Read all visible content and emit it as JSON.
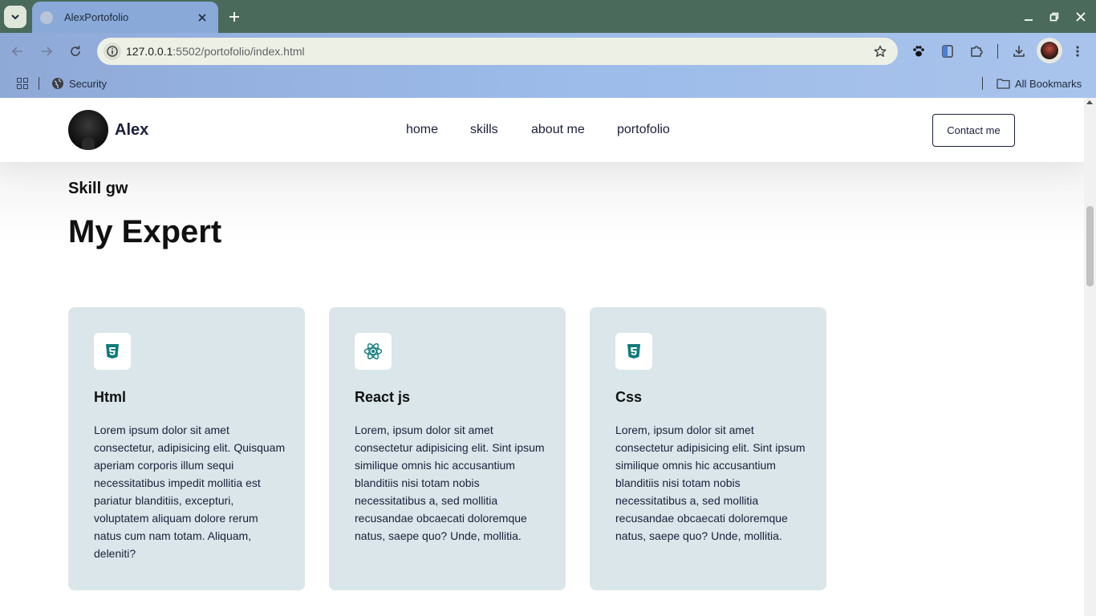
{
  "browser": {
    "tab_title": "AlexPortofolio",
    "url_host": "127.0.0.1",
    "url_rest": ":5502/portofolio/index.html",
    "bookmarks": {
      "security": "Security",
      "all_bookmarks": "All Bookmarks"
    }
  },
  "site": {
    "brand_name": "Alex",
    "nav": [
      "home",
      "skills",
      "about me",
      "portofolio"
    ],
    "contact_label": "Contact me"
  },
  "skills": {
    "eyebrow": "Skill gw",
    "heading": "My Expert",
    "cards": [
      {
        "icon": "html5-icon",
        "title": "Html",
        "text": "Lorem ipsum dolor sit amet consectetur, adipisicing elit. Quisquam aperiam corporis illum sequi necessitatibus impedit mollitia est pariatur blanditiis, excepturi, voluptatem aliquam dolore rerum natus cum nam totam. Aliquam, deleniti?"
      },
      {
        "icon": "react-icon",
        "title": "React js",
        "text": "Lorem, ipsum dolor sit amet consectetur adipisicing elit. Sint ipsum similique omnis hic accusantium blanditiis nisi totam nobis necessitatibus a, sed mollitia recusandae obcaecati doloremque natus, saepe quo? Unde, mollitia."
      },
      {
        "icon": "css3-icon",
        "title": "Css",
        "text": "Lorem, ipsum dolor sit amet consectetur adipisicing elit. Sint ipsum similique omnis hic accusantium blanditiis nisi totam nobis necessitatibus a, sed mollitia recusandae obcaecati doloremque natus, saepe quo? Unde, mollitia."
      }
    ]
  },
  "colors": {
    "card_bg": "#dae6e9",
    "icon_accent": "#0f7b7b",
    "text_dark": "#1a1f3c"
  }
}
